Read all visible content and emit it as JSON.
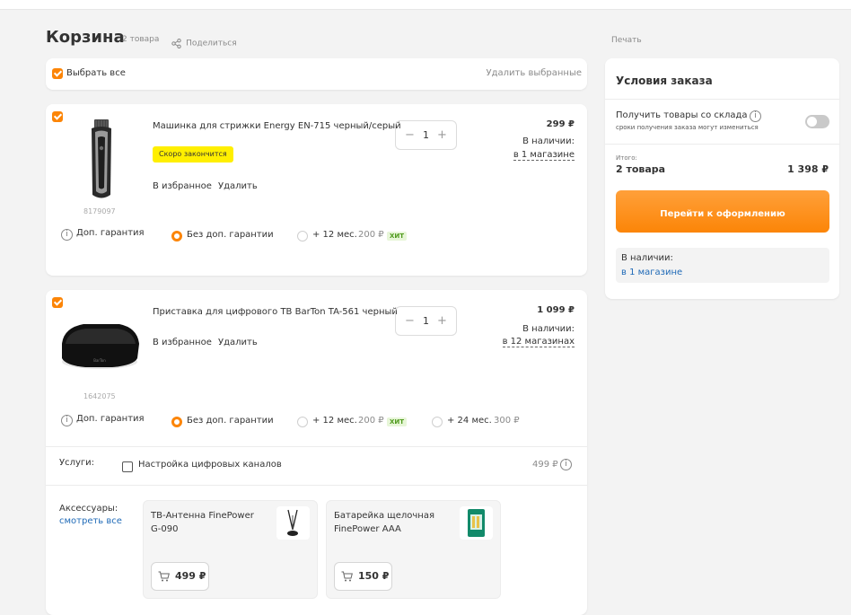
{
  "colors": {
    "accent": "#fc8507",
    "checkout_gradient": [
      "#ffa03a",
      "#fc8507"
    ],
    "badge_yellow": "#ffef00",
    "hit_green": "#4f9a1d",
    "link_blue": "#1f6ab7"
  },
  "header": {
    "title": "Корзина",
    "count": "2 товара",
    "share": "Поделиться",
    "print": "Печать"
  },
  "selection": {
    "select_all": "Выбрать все",
    "delete_selected": "Удалить выбранные"
  },
  "items": [
    {
      "name": "Машинка для стрижки Energy EN-715 черный/серый",
      "code": "8179097",
      "badge": "Скоро закончится",
      "favorite": "В избранное",
      "delete": "Удалить",
      "qty": "1",
      "price": "299 ₽",
      "stock_label": "В наличии:",
      "stock_link": "в 1 магазине",
      "warranty": {
        "label": "Доп. гарантия",
        "options": [
          {
            "label": "Без доп. гарантии",
            "selected": true
          },
          {
            "label": "+ 12 мес.",
            "price": "200 ₽",
            "badge": "ХИТ",
            "selected": false
          }
        ]
      }
    },
    {
      "name": "Приставка для цифрового ТВ BarTon TA-561 черный",
      "code": "1642075",
      "favorite": "В избранное",
      "delete": "Удалить",
      "qty": "1",
      "price": "1 099 ₽",
      "stock_label": "В наличии:",
      "stock_link": "в 12 магазинах",
      "warranty": {
        "label": "Доп. гарантия",
        "options": [
          {
            "label": "Без доп. гарантии",
            "selected": true
          },
          {
            "label": "+ 12 мес.",
            "price": "200 ₽",
            "badge": "ХИТ",
            "selected": false
          },
          {
            "label": "+ 24 мес.",
            "price": "300 ₽",
            "selected": false
          }
        ]
      },
      "services": {
        "label": "Услуги:",
        "option": "Настройка цифровых каналов",
        "price": "499 ₽"
      },
      "accessories": {
        "label": "Аксессуары:",
        "link": "смотреть все",
        "list": [
          {
            "name": "ТВ-Антенна FinePower G-090",
            "price": "499 ₽"
          },
          {
            "name": "Батарейка щелочная FinePower AAA",
            "price": "150 ₽"
          }
        ]
      }
    }
  ],
  "order": {
    "title": "Условия заказа",
    "warehouse_label": "Получить товары со склада",
    "warehouse_note": "сроки получения заказа могут измениться",
    "total_label": "Итого:",
    "total_count": "2 товара",
    "total_price": "1 398 ₽",
    "checkout": "Перейти к оформлению",
    "stock_label": "В наличии:",
    "stock_link": "в 1 магазине"
  }
}
